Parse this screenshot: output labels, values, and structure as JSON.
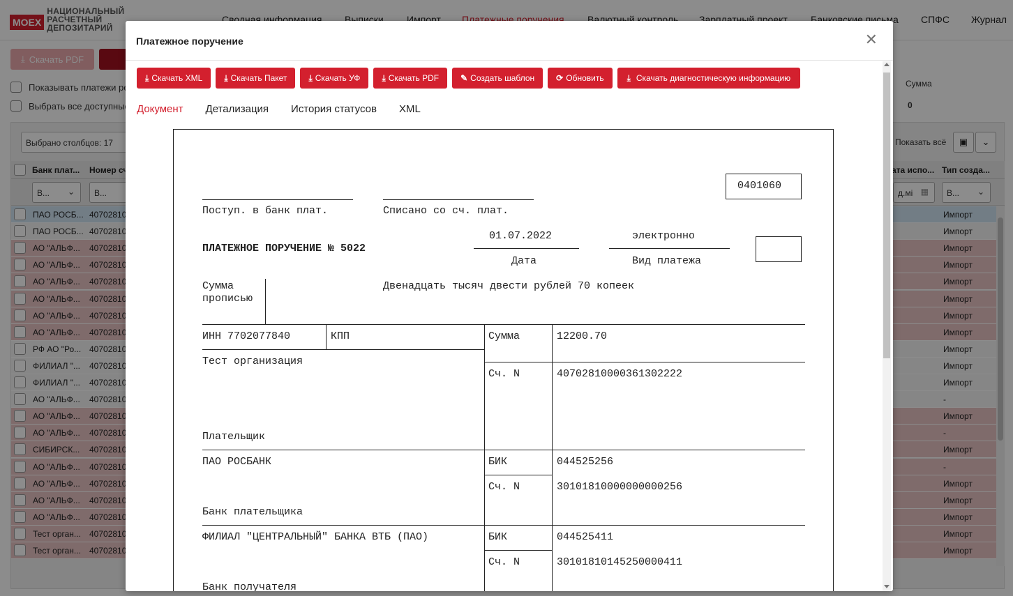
{
  "header": {
    "logo_badge": "MOEX",
    "logo_line1": "НАЦИОНАЛЬНЫЙ",
    "logo_line2": "РАСЧЕТНЫЙ",
    "logo_line3": "ДЕПОЗИТАРИЙ",
    "nav": [
      "Сводная информация",
      "Выписки",
      "Импорт",
      "Платежные поручения",
      "Валютный контроль",
      "Зарплатный проект",
      "Банковские письма",
      "СПФС",
      "Журнал"
    ],
    "active_nav": "Платежные поручения"
  },
  "bg_toolbar": {
    "download_pdf": "Скачать PDF",
    "chk_show_payments": "Показывать платежи рее",
    "chk_select_all": "Выбрать все доступные",
    "columns_selected": "Выбрано столбцов: 17",
    "sum_label": "Сумма",
    "sum_value": "0",
    "show_all": "Показать всё"
  },
  "grid": {
    "col_bank": "Банк плат...",
    "col_account": "Номер сч",
    "col_date_exec": "ата испо...",
    "col_type": "Тип созда...",
    "filter_placeholder": "В...",
    "date_placeholder": "д.мі",
    "rows": [
      {
        "bank": "ПАО РОСБ...",
        "acc": "40702810",
        "type": "Импорт",
        "style": "blue"
      },
      {
        "bank": "ПАО РОСБ...",
        "acc": "40702810",
        "type": "Импорт",
        "style": "white"
      },
      {
        "bank": "АО \"АЛЬФ...",
        "acc": "40702810",
        "type": "Импорт",
        "style": "pink"
      },
      {
        "bank": "АО \"АЛЬФ...",
        "acc": "40702810",
        "type": "Импорт",
        "style": "pink"
      },
      {
        "bank": "АО \"АЛЬФ...",
        "acc": "40702810",
        "type": "Импорт",
        "style": "pink"
      },
      {
        "bank": "АО \"АЛЬФ...",
        "acc": "40702810",
        "type": "Импорт",
        "style": "pink"
      },
      {
        "bank": "АО \"АЛЬФ...",
        "acc": "40702810",
        "type": "Импорт",
        "style": "pink"
      },
      {
        "bank": "АО \"АЛЬФ...",
        "acc": "40702810",
        "type": "Импорт",
        "style": "pink"
      },
      {
        "bank": "РФ АО \"Ро...",
        "acc": "40702810",
        "type": "Импорт",
        "style": "white"
      },
      {
        "bank": "ФИЛИАЛ \"...",
        "acc": "40702810",
        "type": "Импорт",
        "style": "white"
      },
      {
        "bank": "ФИЛИАЛ \"...",
        "acc": "40702810",
        "type": "Импорт",
        "style": "white"
      },
      {
        "bank": "АО \"АЛЬФ...",
        "acc": "40702810",
        "type": "-",
        "style": "white"
      },
      {
        "bank": "АО \"АЛЬФ...",
        "acc": "40702810",
        "type": "Импорт",
        "style": "pink"
      },
      {
        "bank": "АО \"АЛЬФ...",
        "acc": "40702810",
        "type": "-",
        "style": "pink"
      },
      {
        "bank": "СИБИРСК...",
        "acc": "40702810",
        "type": "Импорт",
        "style": "pink"
      },
      {
        "bank": "АО \"АЛЬФ...",
        "acc": "40702810",
        "type": "-",
        "style": "pink"
      },
      {
        "bank": "АО \"АЛЬФ...",
        "acc": "40702810",
        "type": "Импорт",
        "style": "pink"
      },
      {
        "bank": "АО \"АЛЬФ...",
        "acc": "40702810",
        "type": "Импорт",
        "style": "pink"
      },
      {
        "bank": "АО \"АЛЬФ...",
        "acc": "40702810",
        "type": "Импорт",
        "style": "pink"
      },
      {
        "bank": "Тест орган...",
        "acc": "40702810",
        "type": "Импорт",
        "style": "pink"
      },
      {
        "bank": "Тест орган...",
        "acc": "40702810",
        "type": "Импорт",
        "style": "pink"
      }
    ]
  },
  "modal": {
    "title": "Платежное поручение",
    "buttons": [
      "Скачать XML",
      "Скачать Пакет",
      "Скачать УФ",
      "Скачать PDF",
      "Создать шаблон",
      "Обновить",
      "Скачать диагностическую информацию"
    ],
    "tabs": [
      "Документ",
      "Детализация",
      "История статусов",
      "XML"
    ],
    "active_tab": "Документ"
  },
  "document": {
    "form_code": "0401060",
    "received_label": "Поступ. в банк плат.",
    "debited_label": "Списано со сч. плат.",
    "title": "ПЛАТЕЖНОЕ ПОРУЧЕНИЕ  № 5022",
    "date_value": "01.07.2022",
    "date_label": "Дата",
    "payment_type_value": "электронно",
    "payment_type_label": "Вид платежа",
    "sum_words_label_1": "Сумма",
    "sum_words_label_2": "прописью",
    "sum_words_value": "Двенадцать тысяч двести рублей 70 копеек",
    "inn": "ИНН 7702077840",
    "kpp": "КПП",
    "sum_label": "Сумма",
    "sum_value": "12200.70",
    "payer_name": "Тест организация",
    "acc_label": "Сч. N",
    "payer_account": "40702810000361302222",
    "payer_label": "Плательщик",
    "payer_bank": "ПАО РОСБАНК",
    "bik_label": "БИК",
    "payer_bik": "044525256",
    "payer_bank_corr": "30101810000000000256",
    "payer_bank_label": "Банк плательщика",
    "recipient_bank": "ФИЛИАЛ \"ЦЕНТРАЛЬНЫЙ\" БАНКА ВТБ (ПАО)",
    "recipient_bik": "044525411",
    "recipient_bank_corr": "30101810145250000411",
    "recipient_bank_label": "Банк получателя"
  },
  "colors": {
    "accent": "#d3202e",
    "row_pink": "#e8c4c4",
    "row_blue": "#cfe3f3"
  }
}
